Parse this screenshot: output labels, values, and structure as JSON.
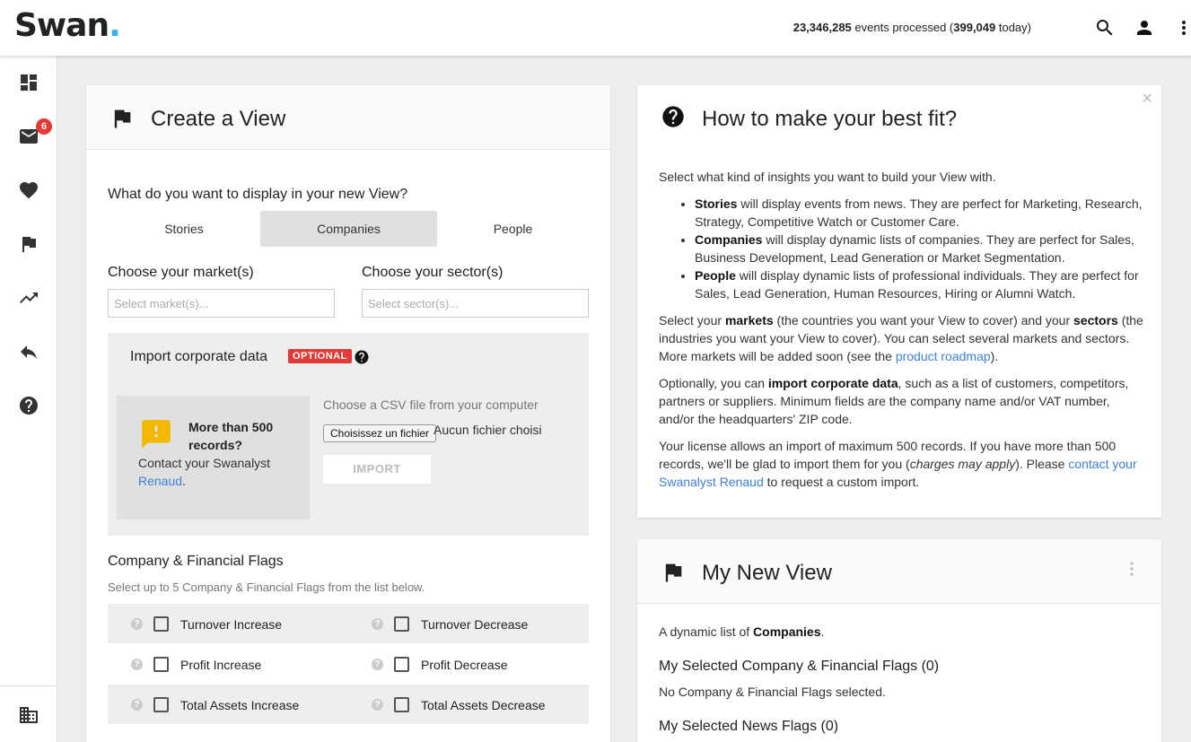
{
  "app": {
    "logo_text": "Swan",
    "logo_dot": "."
  },
  "header": {
    "events_total": "23,346,285",
    "events_mid": " events processed (",
    "events_today": "399,049",
    "events_end": " today)",
    "icons": [
      "search-icon",
      "account-icon",
      "more-vert-icon"
    ]
  },
  "sidebar": {
    "items": [
      {
        "name": "dashboard-icon"
      },
      {
        "name": "mail-icon",
        "badge": "6"
      },
      {
        "name": "heart-icon"
      },
      {
        "name": "flag-icon"
      },
      {
        "name": "trending-up-icon"
      },
      {
        "name": "reply-icon"
      },
      {
        "name": "help-icon"
      }
    ],
    "bottom_item": "business-icon"
  },
  "create_view": {
    "title": "Create a View",
    "question": "What do you want to display in your new View?",
    "tabs": [
      {
        "label": "Stories",
        "active": false
      },
      {
        "label": "Companies",
        "active": true
      },
      {
        "label": "People",
        "active": false
      }
    ],
    "markets_label": "Choose your market(s)",
    "markets_placeholder": "Select market(s)...",
    "sectors_label": "Choose your sector(s)",
    "sectors_placeholder": "Select sector(s)...",
    "import": {
      "title": "Import corporate data",
      "optional_badge": "OPTIONAL",
      "warning_title": "More than 500 records?",
      "warning_text": "Contact your Swanalyst ",
      "warning_link": "Renaud",
      "warning_end": ".",
      "csv_label": "Choose a CSV file from your computer",
      "file_button": "Choisissez un fichier",
      "file_name": "Aucun fichier choisi",
      "import_button": "IMPORT"
    },
    "flags_title": "Company & Financial Flags",
    "flags_subtitle": "Select up to 5 Company & Financial Flags from the list below.",
    "flag_rows": [
      {
        "left": "Turnover Increase",
        "right": "Turnover Decrease"
      },
      {
        "left": "Profit Increase",
        "right": "Profit Decrease"
      },
      {
        "left": "Total Assets Increase",
        "right": "Total Assets Decrease"
      }
    ]
  },
  "help": {
    "title": "How to make your best fit?",
    "intro": "Select what kind of insights you want to build your View with.",
    "bullets": [
      {
        "term": "Stories",
        "text": " will display events from news. They are perfect for Marketing, Research, Strategy, Competitive Watch or Customer Care."
      },
      {
        "term": "Companies",
        "text": " will display dynamic lists of companies. They are perfect for Sales, Business Development, Lead Generation or Market Segmentation."
      },
      {
        "term": "People",
        "text": " will display dynamic lists of professional individuals. They are perfect for Sales, Lead Generation, Human Resources, Hiring or Alumni Watch."
      }
    ],
    "p2_a": "Select your ",
    "p2_markets": "markets",
    "p2_b": " (the countries you want your View to cover) and your ",
    "p2_sectors": "sectors",
    "p2_c": " (the industries you want your View to cover). You can select several markets and sectors. More markets will be added soon (see the ",
    "p2_link": "product roadmap",
    "p2_d": ").",
    "p3_a": "Optionally, you can ",
    "p3_bold": "import corporate data",
    "p3_b": ", such as a list of customers, competitors, partners or suppliers. Minimum fields are the company name and/or VAT number, and/or the headquarters' ZIP code.",
    "p4_a": "Your license allows an import of maximum 500 records. If you have more than 500 records, we'll be glad to import them for you (",
    "p4_italic": "charges may apply",
    "p4_b": "). Please ",
    "p4_link": "contact your Swanalyst Renaud",
    "p4_c": " to request a custom import."
  },
  "new_view": {
    "title": "My New View",
    "desc_a": "A dynamic list of ",
    "desc_bold": "Companies",
    "desc_b": ".",
    "flags_heading": "My Selected Company & Financial Flags (0)",
    "flags_none": "No Company & Financial Flags selected.",
    "news_heading": "My Selected News Flags (0)"
  },
  "colors": {
    "accent": "#2bb5e6",
    "badge": "#e53935",
    "link": "#3d7fdc",
    "warning": "#f5b800"
  }
}
